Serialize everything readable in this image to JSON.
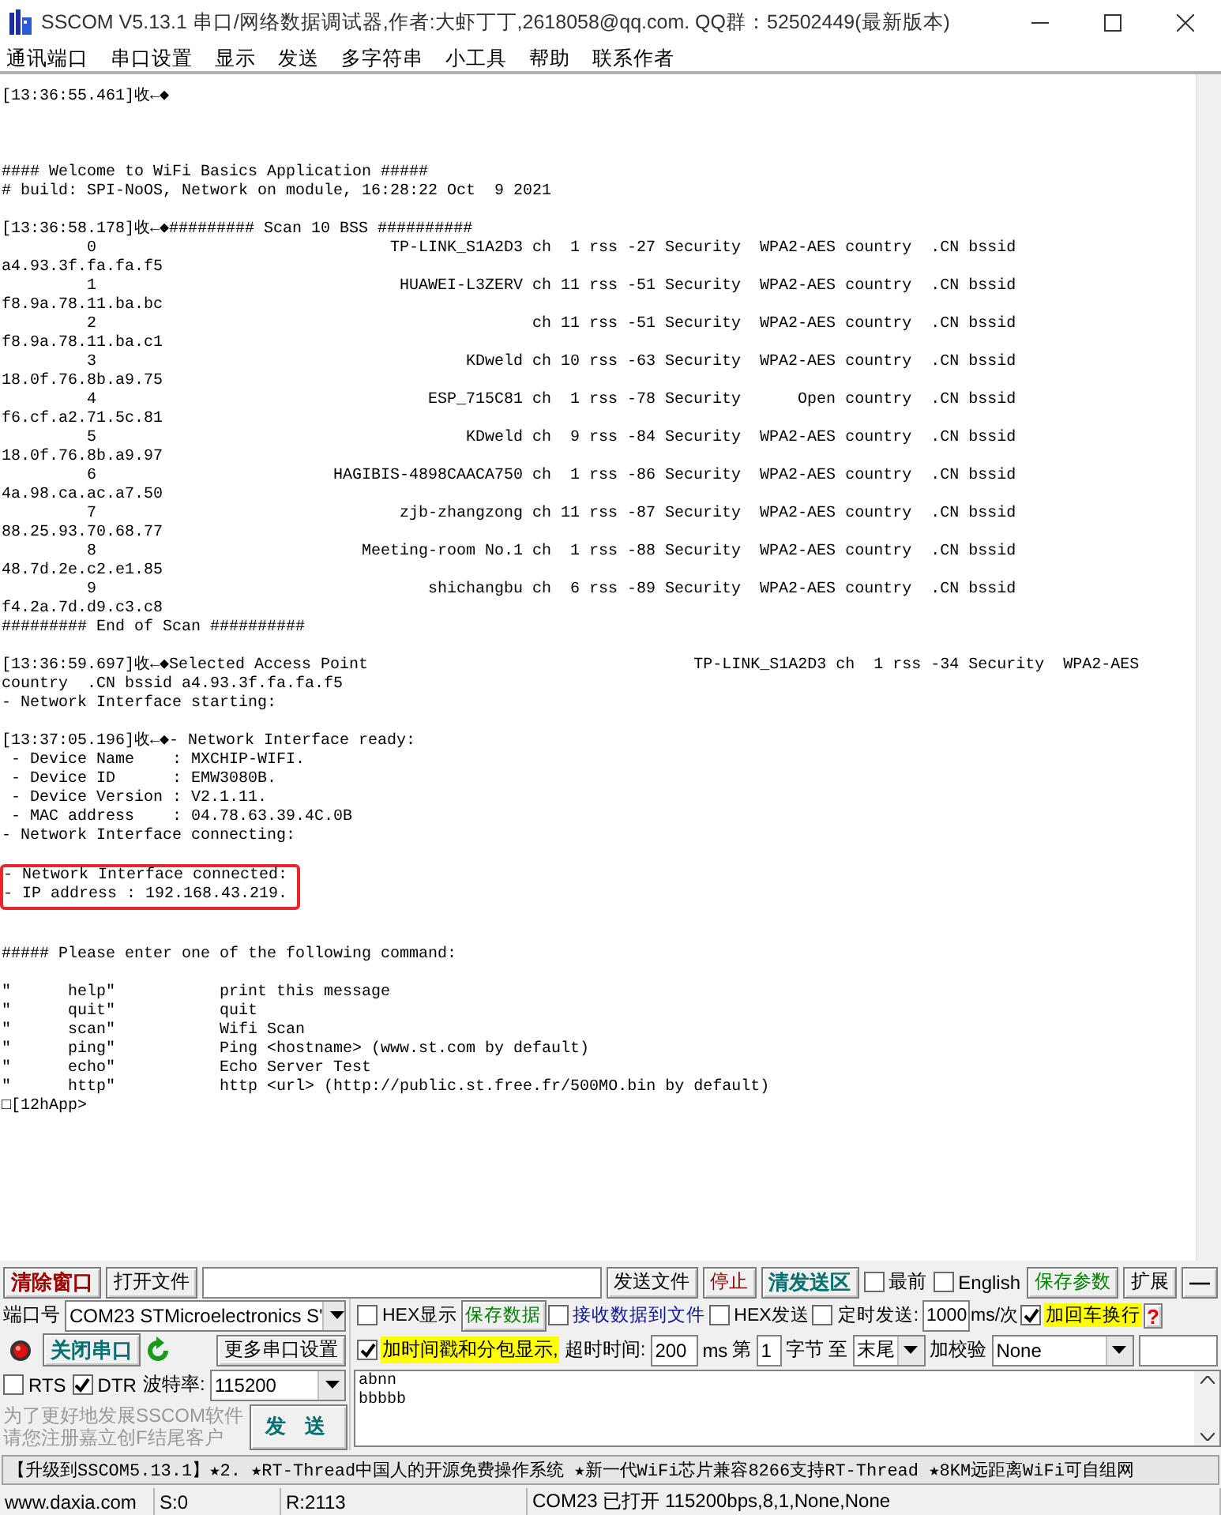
{
  "window": {
    "title": "SSCOM V5.13.1 串口/网络数据调试器,作者:大虾丁丁,2618058@qq.com. QQ群：52502449(最新版本)"
  },
  "menu": [
    "通讯端口",
    "串口设置",
    "显示",
    "发送",
    "多字符串",
    "小工具",
    "帮助",
    "联系作者"
  ],
  "terminal": {
    "entries": [
      {
        "kind": "line",
        "text": "[13:36:55.461]收←◆"
      },
      {
        "kind": "blank"
      },
      {
        "kind": "blank"
      },
      {
        "kind": "blank"
      },
      {
        "kind": "line",
        "text": "#### Welcome to WiFi Basics Application #####"
      },
      {
        "kind": "line",
        "text": "# build: SPI-NoOS, Network on module, 16:28:22 Oct  9 2021"
      },
      {
        "kind": "blank"
      },
      {
        "kind": "line",
        "text": "[13:36:58.178]收←◆######### Scan 10 BSS ##########"
      },
      {
        "kind": "scan",
        "index": "0",
        "name": "TP-LINK_S1A2D3",
        "details": "ch  1 rss -27 Security  WPA2-AES country  .CN bssid",
        "bssid": "a4.93.3f.fa.fa.f5"
      },
      {
        "kind": "scan",
        "index": "1",
        "name": "HUAWEI-L3ZERV",
        "details": "ch 11 rss -51 Security  WPA2-AES country  .CN bssid",
        "bssid": "f8.9a.78.11.ba.bc"
      },
      {
        "kind": "scan",
        "index": "2",
        "details": "ch 11 rss -51 Security  WPA2-AES country  .CN bssid",
        "bssid": "f8.9a.78.11.ba.c1"
      },
      {
        "kind": "scan",
        "index": "3",
        "name": "KDweld",
        "details": "ch 10 rss -63 Security  WPA2-AES country  .CN bssid",
        "bssid": "18.0f.76.8b.a9.75"
      },
      {
        "kind": "scan",
        "index": "4",
        "name": "ESP_715C81",
        "details": "ch  1 rss -78 Security      Open country  .CN bssid",
        "bssid": "f6.cf.a2.71.5c.81"
      },
      {
        "kind": "scan",
        "index": "5",
        "name": "KDweld",
        "details": "ch  9 rss -84 Security  WPA2-AES country  .CN bssid",
        "bssid": "18.0f.76.8b.a9.97"
      },
      {
        "kind": "scan",
        "index": "6",
        "name": "HAGIBIS-4898CAACA750",
        "details": "ch  1 rss -86 Security  WPA2-AES country  .CN bssid",
        "bssid": "4a.98.ca.ac.a7.50"
      },
      {
        "kind": "scan",
        "index": "7",
        "name": "zjb-zhangzong",
        "details": "ch 11 rss -87 Security  WPA2-AES country  .CN bssid",
        "bssid": "88.25.93.70.68.77"
      },
      {
        "kind": "scan",
        "index": "8",
        "name": "Meeting-room No.1",
        "details": "ch  1 rss -88 Security  WPA2-AES country  .CN bssid",
        "bssid": "48.7d.2e.c2.e1.85"
      },
      {
        "kind": "scan",
        "index": "9",
        "name": "shichangbu",
        "details": "ch  6 rss -89 Security  WPA2-AES country  .CN bssid",
        "bssid": "f4.2a.7d.d9.c3.c8"
      },
      {
        "kind": "line",
        "text": "######### End of Scan ##########"
      },
      {
        "kind": "blank"
      },
      {
        "kind": "split",
        "left": "[13:36:59.697]收←◆Selected Access Point",
        "right": "TP-LINK_S1A2D3 ch  1 rss -34 Security  WPA2-AES"
      },
      {
        "kind": "line",
        "text": "country  .CN bssid a4.93.3f.fa.fa.f5"
      },
      {
        "kind": "line",
        "text": "- Network Interface starting:"
      },
      {
        "kind": "blank"
      },
      {
        "kind": "line",
        "text": "[13:37:05.196]收←◆- Network Interface ready:"
      },
      {
        "kind": "line",
        "text": " - Device Name    : MXCHIP-WIFI."
      },
      {
        "kind": "line",
        "text": " - Device ID      : EMW3080B."
      },
      {
        "kind": "line",
        "text": " - Device Version : V2.1.11."
      },
      {
        "kind": "line",
        "text": " - MAC address    : 04.78.63.39.4C.0B"
      },
      {
        "kind": "line",
        "text": "- Network Interface connecting:"
      },
      {
        "kind": "blank"
      },
      {
        "kind": "highlight",
        "lines": [
          "- Network Interface connected:",
          "- IP address : 192.168.43.219."
        ]
      },
      {
        "kind": "blank"
      },
      {
        "kind": "blank"
      },
      {
        "kind": "line",
        "text": "##### Please enter one of the following command:"
      },
      {
        "kind": "blank"
      },
      {
        "kind": "line",
        "text": "\"      help\"           print this message"
      },
      {
        "kind": "line",
        "text": "\"      quit\"           quit"
      },
      {
        "kind": "line",
        "text": "\"      scan\"           Wifi Scan"
      },
      {
        "kind": "line",
        "text": "\"      ping\"           Ping <hostname> (www.st.com by default)"
      },
      {
        "kind": "line",
        "text": "\"      echo\"           Echo Server Test"
      },
      {
        "kind": "line",
        "text": "\"      http\"           http <url> (http://public.st.free.fr/500MO.bin by default)"
      },
      {
        "kind": "line",
        "text": "□[12hApp>"
      }
    ]
  },
  "send_toolbar": {
    "clear_window": "清除窗口",
    "open_file": "打开文件",
    "send_file": "发送文件",
    "stop": "停止",
    "clear_send": "清发送区",
    "topmost": {
      "label": "最前",
      "checked": false
    },
    "english": {
      "label": "English",
      "checked": false
    },
    "save_params": "保存参数",
    "expand": "扩展",
    "collapse": "—"
  },
  "port": {
    "label": "端口号",
    "value": "COM23 STMicroelectronics S'",
    "close_port": "关闭串口",
    "more_settings": "更多串口设置",
    "rts": {
      "label": "RTS",
      "checked": false
    },
    "dtr": {
      "label": "DTR",
      "checked": true
    },
    "baud_label": "波特率:",
    "baud": "115200",
    "promo": [
      "为了更好地发展SSCOM软件",
      "请您注册嘉立创F结尾客户"
    ],
    "send": "发 送"
  },
  "receive_options": {
    "hex_display": {
      "label": "HEX显示",
      "checked": false
    },
    "save_data": "保存数据",
    "to_file": {
      "label": "接收数据到文件",
      "checked": false
    },
    "timestamp": {
      "label": "加时间戳和分包显示,",
      "checked": true
    },
    "timeout_label": "超时时间:",
    "timeout": "200",
    "timeout_unit": "ms",
    "from_label": "第",
    "from": "1",
    "bytes_label": "字节",
    "to_label": "至",
    "to": "末尾"
  },
  "send_options": {
    "hex_send": {
      "label": "HEX发送",
      "checked": false
    },
    "timed_send": {
      "label": "定时发送:",
      "checked": false
    },
    "interval": "1000",
    "interval_unit": "ms/次",
    "add_crlf": {
      "label": "加回车换行",
      "checked": true
    },
    "help": "?",
    "checksum_label": "加校验",
    "checksum": "None"
  },
  "send_text": "abnn\nbbbbb",
  "ticker": "【升级到SSCOM5.13.1】★2. ★RT-Thread中国人的开源免费操作系统 ★新一代WiFi芯片兼容8266支持RT-Thread ★8KM远距离WiFi可自组网",
  "status_bar": [
    "www.daxia.com",
    "S:0",
    "R:2113",
    "COM23 已打开  115200bps,8,1,None,None"
  ]
}
